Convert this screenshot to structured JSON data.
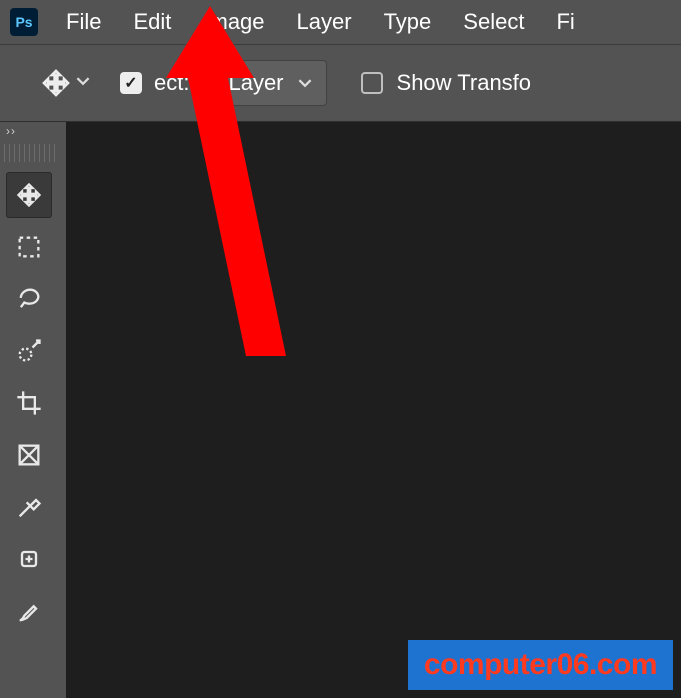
{
  "app": {
    "logo_text": "Ps"
  },
  "menubar": {
    "items": [
      "File",
      "Edit",
      "Image",
      "Layer",
      "Type",
      "Select",
      "Fi"
    ]
  },
  "optionsbar": {
    "auto_select_checked": true,
    "auto_select_label_suffix": "ect:",
    "dropdown_value": "Layer",
    "show_transform_checked": false,
    "show_transform_label": "Show Transfo"
  },
  "tools": {
    "items": [
      {
        "id": "move-tool",
        "selected": true
      },
      {
        "id": "rect-marquee-tool",
        "selected": false
      },
      {
        "id": "lasso-tool",
        "selected": false
      },
      {
        "id": "quick-selection-tool",
        "selected": false
      },
      {
        "id": "crop-tool",
        "selected": false
      },
      {
        "id": "frame-tool",
        "selected": false
      },
      {
        "id": "eyedropper-tool",
        "selected": false
      },
      {
        "id": "healing-brush-tool",
        "selected": false
      },
      {
        "id": "brush-tool",
        "selected": false
      }
    ]
  },
  "annotation": {
    "arrow_color": "#ff0000",
    "points_to": "menu-edit"
  },
  "watermark": {
    "text": "computer06.com",
    "bg": "#1e72d0",
    "fg": "#ff3a1f"
  }
}
